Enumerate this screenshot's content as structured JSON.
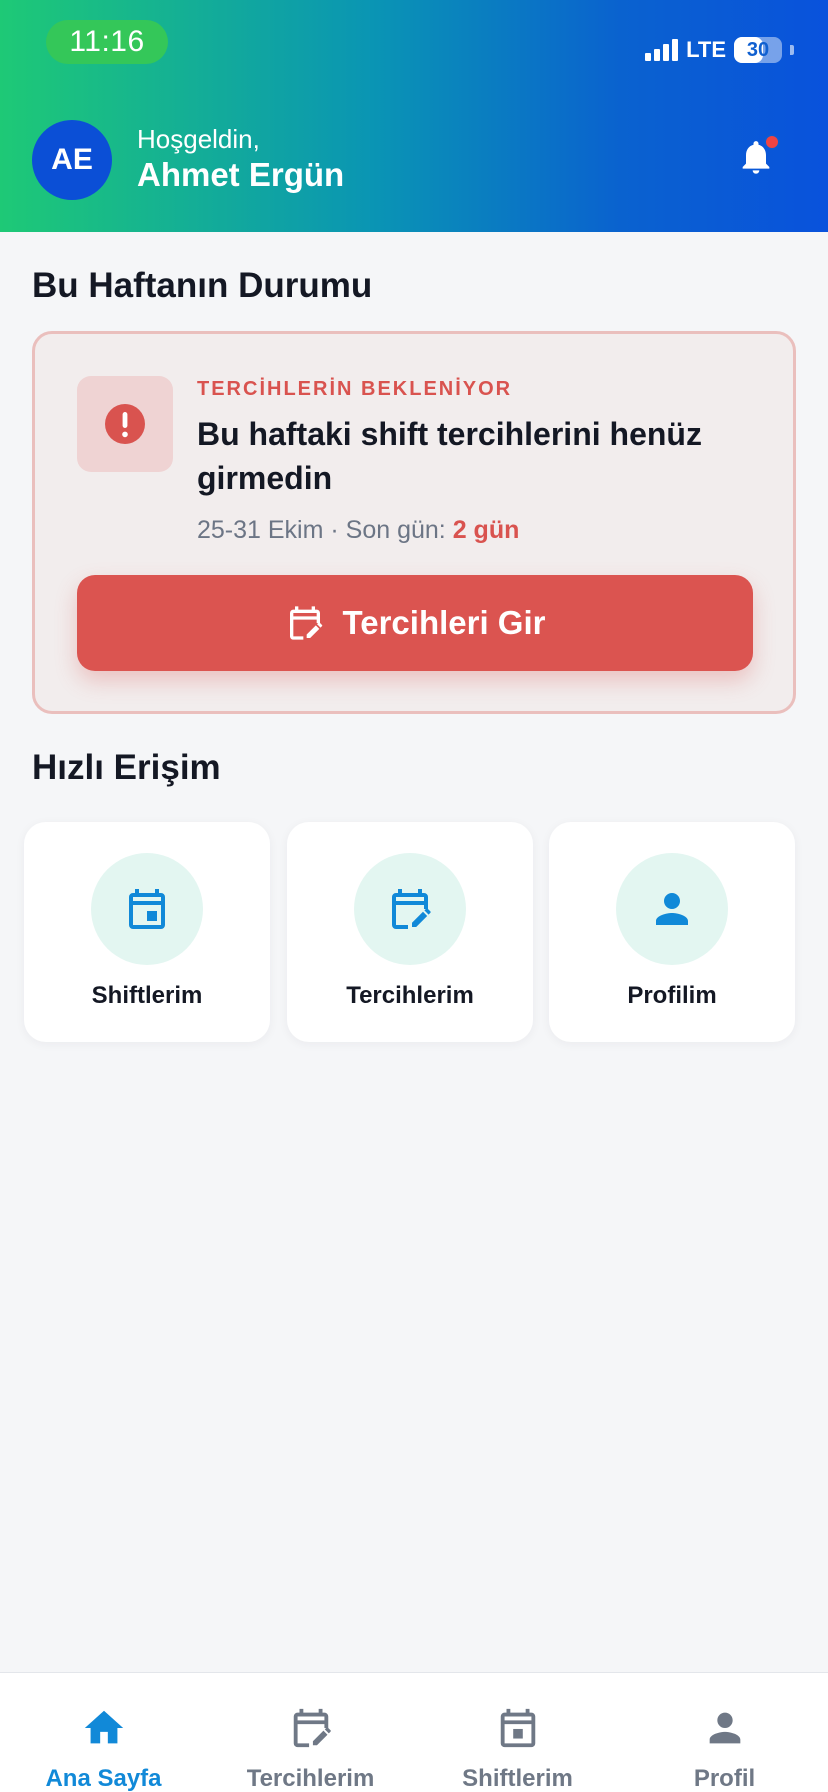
{
  "status_bar": {
    "time": "11:16",
    "network": "LTE",
    "battery": "30"
  },
  "header": {
    "avatar_initials": "AE",
    "greeting": "Hoşgeldin,",
    "user_name": "Ahmet Ergün"
  },
  "week_status": {
    "title": "Bu Haftanın Durumu",
    "badge": "TERCİHLERİN BEKLENİYOR",
    "heading": "Bu haftaki shift tercihlerini henüz girmedin",
    "date_range": "25-31 Ekim · Son gün: ",
    "deadline": "2 gün",
    "button_label": "Tercihleri Gir",
    "accent_color": "#db5450"
  },
  "quick_access": {
    "title": "Hızlı Erişim",
    "items": [
      {
        "label": "Shiftlerim",
        "icon": "calendar-icon"
      },
      {
        "label": "Tercihlerim",
        "icon": "calendar-edit-icon"
      },
      {
        "label": "Profilim",
        "icon": "person-icon"
      }
    ]
  },
  "bottom_nav": {
    "items": [
      {
        "label": "Ana Sayfa",
        "icon": "home-icon",
        "active": true
      },
      {
        "label": "Tercihlerim",
        "icon": "calendar-edit-icon",
        "active": false
      },
      {
        "label": "Shiftlerim",
        "icon": "calendar-icon",
        "active": false
      },
      {
        "label": "Profil",
        "icon": "person-icon",
        "active": false
      }
    ],
    "active_color": "#1189d8"
  }
}
